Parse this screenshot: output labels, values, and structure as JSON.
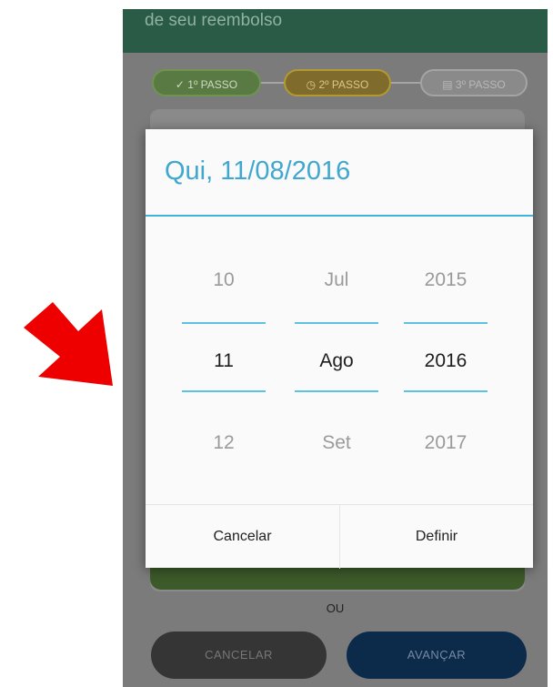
{
  "annotation": {
    "arrow_color": "#ee0000"
  },
  "screen": {
    "appbar_title": "de seu reembolso",
    "steps": [
      "1º PASSO",
      "2º PASSO",
      "3º PASSO"
    ],
    "step_icons": [
      "check-icon",
      "clock-icon",
      "doc-icon"
    ],
    "or_label": "OU",
    "cancel_button": "CANCELAR",
    "next_button": "AVANÇAR"
  },
  "datepicker": {
    "header": "Qui, 11/08/2016",
    "accent_color": "#40b4d8",
    "day": {
      "prev": "10",
      "current": "11",
      "next": "12"
    },
    "month": {
      "prev": "Jul",
      "current": "Ago",
      "next": "Set"
    },
    "year": {
      "prev": "2015",
      "current": "2016",
      "next": "2017"
    },
    "cancel_label": "Cancelar",
    "set_label": "Definir"
  }
}
